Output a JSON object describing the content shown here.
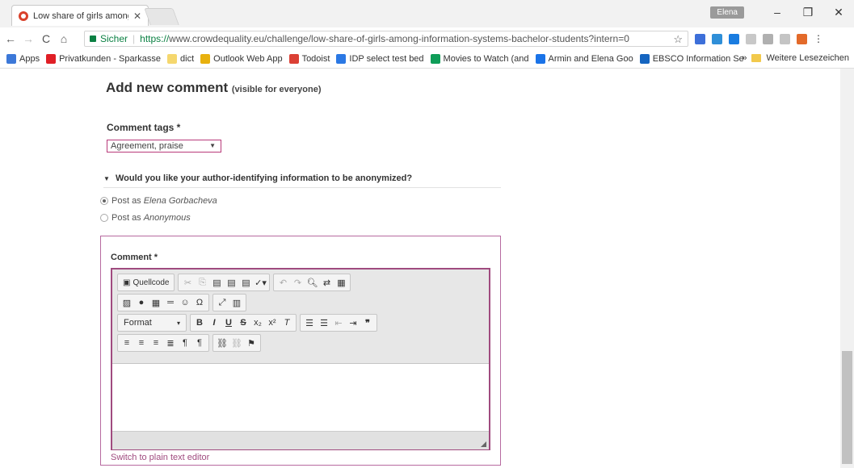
{
  "browser": {
    "tab_title": "Low share of girls among",
    "tab_close": "✕",
    "user_badge": "Elena",
    "min": "–",
    "restore": "❐",
    "close": "✕",
    "secure_label": "Sicher",
    "url_prefix": "https://",
    "url_main": "www.crowdequality.eu/challenge/low-share-of-girls-among-information-systems-bachelor-students?intern=0",
    "bookmarks": [
      {
        "label": "Apps",
        "color": "#3c78d8"
      },
      {
        "label": "Privatkunden - Sparkasse",
        "color": "#e01f26"
      },
      {
        "label": "dict",
        "color": "#f5d76e"
      },
      {
        "label": "Outlook Web App",
        "color": "#e8b10e"
      },
      {
        "label": "Todoist",
        "color": "#db4035"
      },
      {
        "label": "IDP select test bed",
        "color": "#2b78e4"
      },
      {
        "label": "Movies to Watch (and",
        "color": "#0f9d58"
      },
      {
        "label": "Armin and Elena Goo",
        "color": "#1a73e8"
      },
      {
        "label": "EBSCO Information Se",
        "color": "#1565c0"
      }
    ],
    "bookmarks_more": "»",
    "other_bookmarks": "Weitere Lesezeichen"
  },
  "page": {
    "heading": "Add new comment",
    "heading_note": "(visible for everyone)",
    "tags_label": "Comment tags *",
    "tags_value": "Agreement, praise",
    "anon_question": "Would you like your author-identifying information to be anonymized?",
    "post_as_label": "Post as",
    "post_as_name": "Elena Gorbacheva",
    "post_anon_name": "Anonymous",
    "comment_label": "Comment *",
    "source_button": "Quellcode",
    "format_label": "Format",
    "switch_editor": "Switch to plain text editor"
  }
}
